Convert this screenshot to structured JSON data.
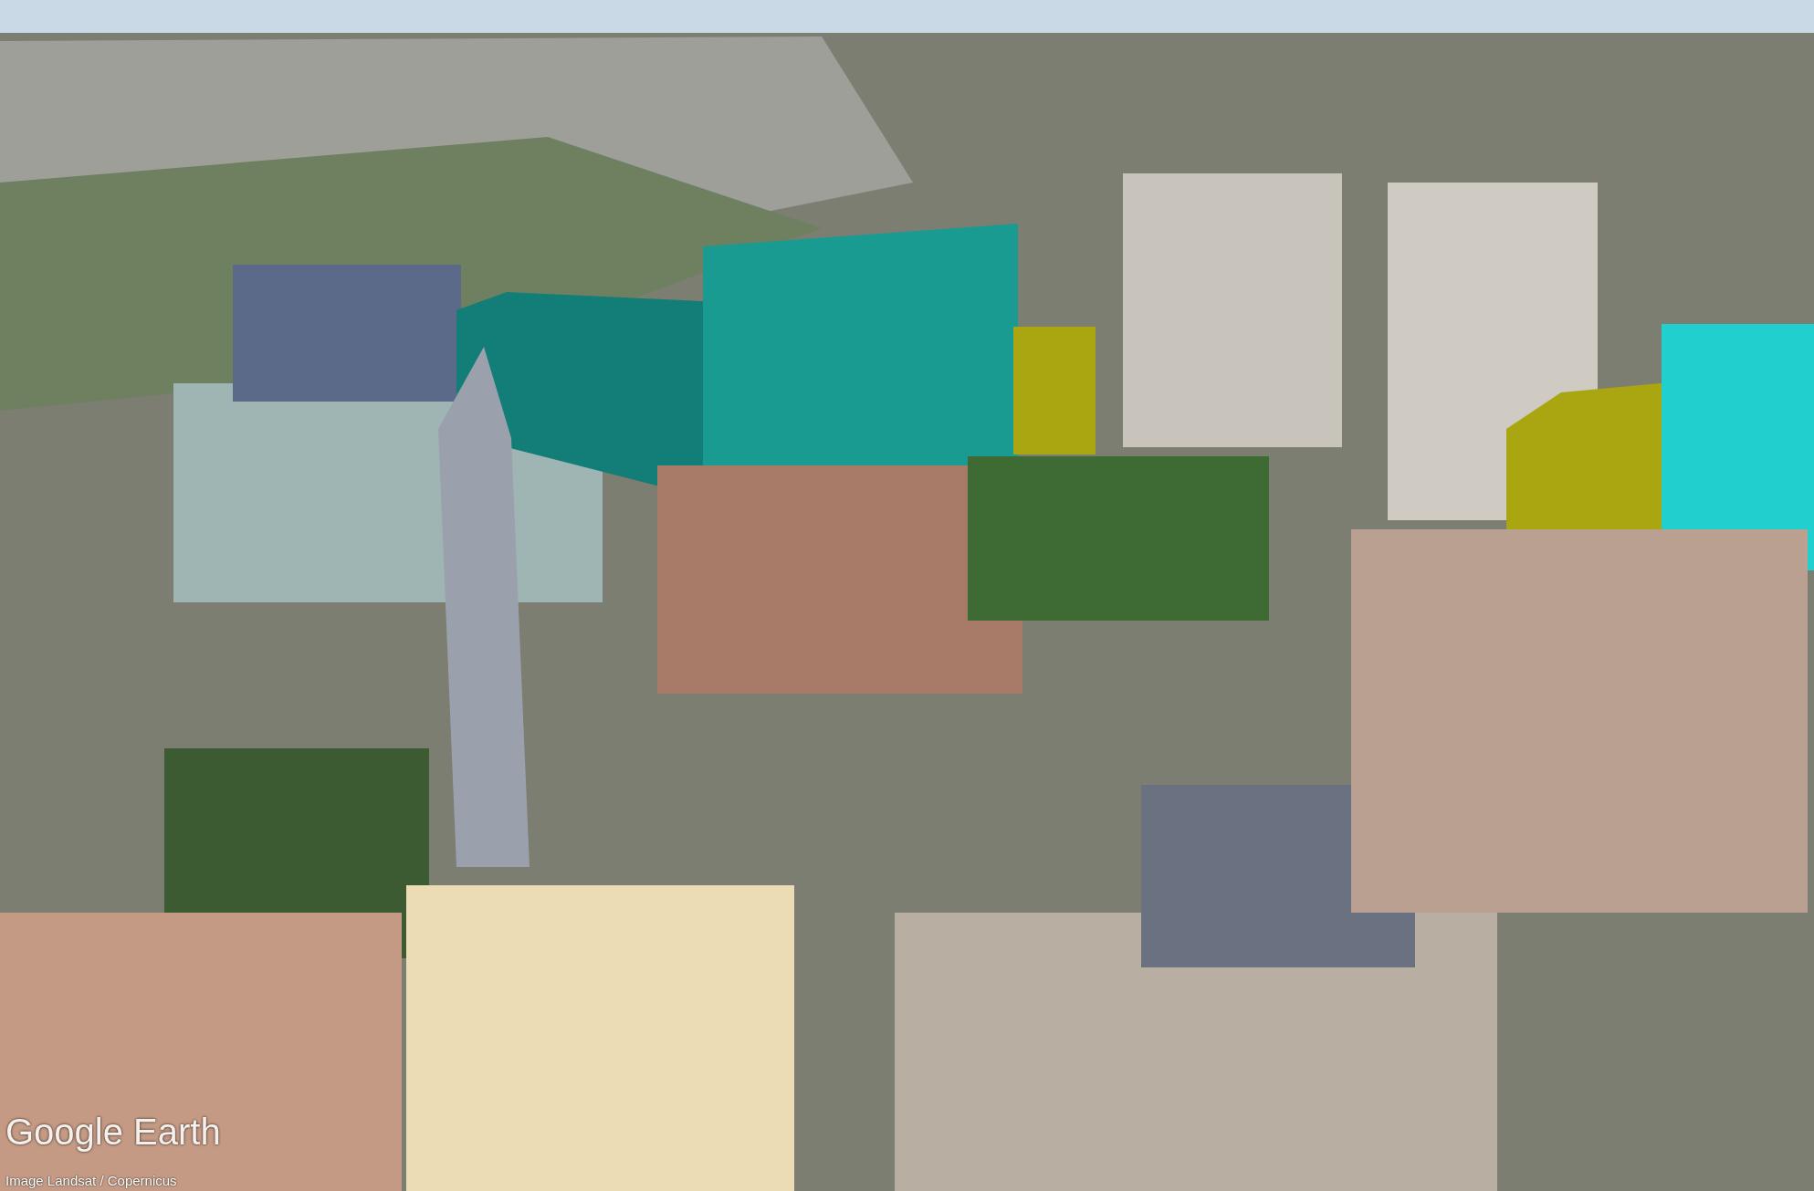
{
  "map": {
    "logo": "Google Earth",
    "attribution": "Image Landsat / Copernicus"
  }
}
